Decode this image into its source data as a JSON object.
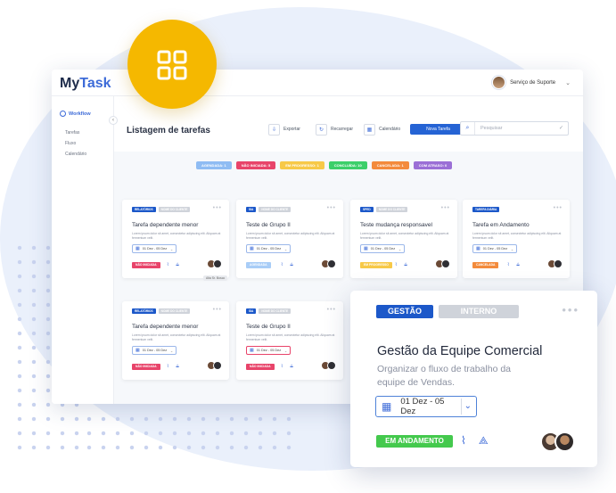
{
  "app": {
    "logo_prefix": "My",
    "logo_suffix": "Task",
    "user_name": "Serviço de Suporte"
  },
  "sidebar": {
    "workflow": "Workflow",
    "items": [
      "Tarefas",
      "Fluxo",
      "Calendário"
    ]
  },
  "header": {
    "title": "Listagem de tarefas",
    "export": "Exportar",
    "reload": "Recarregar",
    "calendar": "Calendário",
    "new_task": "Nova Tarefa",
    "search_placeholder": "Pesquisar"
  },
  "filters": [
    {
      "label": "AGENDADA: 1",
      "color": "#8fbcf3"
    },
    {
      "label": "NÃO INICIADA: 5",
      "color": "#e8446a"
    },
    {
      "label": "EM PROGRESSO: 1",
      "color": "#f7c948"
    },
    {
      "label": "CONCLUÍDA: 10",
      "color": "#3ccf6a"
    },
    {
      "label": "CANCELADA: 1",
      "color": "#f38b3c"
    },
    {
      "label": "COM ATRASO: 0",
      "color": "#9b6fd6"
    }
  ],
  "cards": [
    {
      "tag1": "RELATÓRIOS",
      "tag2": "NOME DO CLIENTE",
      "title": "Tarefa dependente menor",
      "desc": "Lorem ipsum dolor sit amet, consectetur adipiscing elit. Aliquam at fermentum velit.",
      "date": "01 Dez - 05 Dez",
      "status": "NÃO INICIADA",
      "status_color": "#e8446a"
    },
    {
      "tag1": "SIA",
      "tag2": "NOME DO CLIENTE",
      "title": "Teste de Grupo II",
      "desc": "Lorem ipsum dolor sit amet, consectetur adipiscing elit. Aliquam at fermentum velit.",
      "date": "01 Dez - 05 Dez",
      "status": "AGENDADA",
      "status_color": "#a9cdf7"
    },
    {
      "tag1": "SPED",
      "tag2": "NOME DO CLIENTE",
      "title": "Teste mudança responsavel",
      "desc": "Lorem ipsum dolor sit amet, consectetur adipiscing elit. Aliquam at fermentum velit.",
      "date": "01 Dez - 05 Dez",
      "status": "EM PROGRESSO",
      "status_color": "#f7c948"
    },
    {
      "tag1": "TAREFA DIÁRIA",
      "tag2": "",
      "title": "Tarefa em Andamento",
      "desc": "Lorem ipsum dolor sit amet, consectetur adipiscing elit. Aliquam at fermentum velit.",
      "date": "01 Dez - 05 Dez",
      "status": "CANCELADA",
      "status_color": "#f38b3c"
    },
    {
      "tag1": "RELATÓRIOS",
      "tag2": "NOME DO CLIENTE",
      "title": "Tarefa dependente menor",
      "desc": "Lorem ipsum dolor sit amet, consectetur adipiscing elit. Aliquam at fermentum velit.",
      "date": "01 Dez - 05 Dez",
      "status": "NÃO INICIADA",
      "status_color": "#e8446a"
    },
    {
      "tag1": "SIA",
      "tag2": "NOME DO CLIENTE",
      "title": "Teste de Grupo II",
      "desc": "Lorem ipsum dolor sit amet, consectetur adipiscing elit. Aliquam at fermentum velit.",
      "date": "01 Dez - 05 Dez",
      "status": "NÃO INICIADA",
      "status_color": "#e8446a"
    }
  ],
  "tooltip": "Alta Sr. Bosco",
  "detail": {
    "tag1": "GESTÃO",
    "tag2": "INTERNO",
    "title": "Gestão da Equipe Comercial",
    "desc": "Organizar o fluxo de trabalho da equipe de Vendas.",
    "date": "01 Dez - 05 Dez",
    "status": "EM ANDAMENTO"
  },
  "colors": {
    "accent": "#2563d4",
    "logo_circle": "#f5b800",
    "status_green": "#44c94d"
  },
  "icons": [
    "grid-icon",
    "gear-icon",
    "export-icon",
    "reload-icon",
    "calendar-icon",
    "search-icon",
    "check-icon",
    "paperclip-icon",
    "share-icon",
    "chevron-down-icon"
  ]
}
